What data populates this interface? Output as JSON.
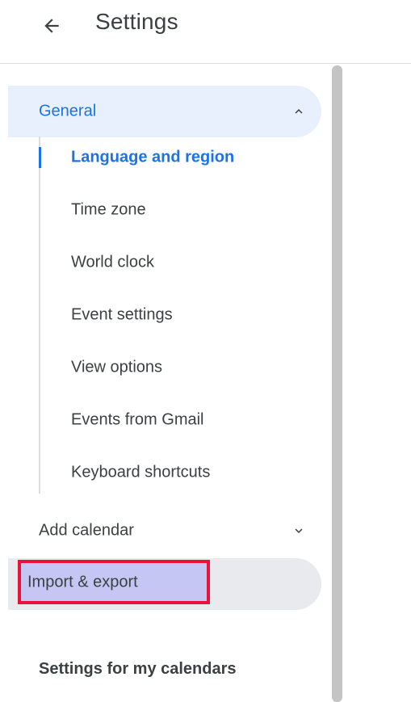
{
  "header": {
    "title": "Settings"
  },
  "nav": {
    "general": {
      "label": "General",
      "expanded": true,
      "items": [
        {
          "label": "Language and region",
          "active": true
        },
        {
          "label": "Time zone",
          "active": false
        },
        {
          "label": "World clock",
          "active": false
        },
        {
          "label": "Event settings",
          "active": false
        },
        {
          "label": "View options",
          "active": false
        },
        {
          "label": "Events from Gmail",
          "active": false
        },
        {
          "label": "Keyboard shortcuts",
          "active": false
        }
      ]
    },
    "add_calendar": {
      "label": "Add calendar",
      "expanded": false
    },
    "import_export": {
      "label": "Import & export"
    },
    "section_heading": "Settings for my calendars"
  },
  "icons": {
    "back": "arrow-left-icon",
    "collapse": "chevron-up-icon",
    "expand": "chevron-down-icon"
  },
  "colors": {
    "accent": "#1a73e8",
    "active_bg": "#e8f0fe",
    "hover_bg": "#e8eaed",
    "highlight_fill": "#c5c6f3",
    "highlight_border": "#e8123b",
    "text": "#3c4043",
    "divider": "#dadce0",
    "scrollbar": "#c4c4c4"
  }
}
